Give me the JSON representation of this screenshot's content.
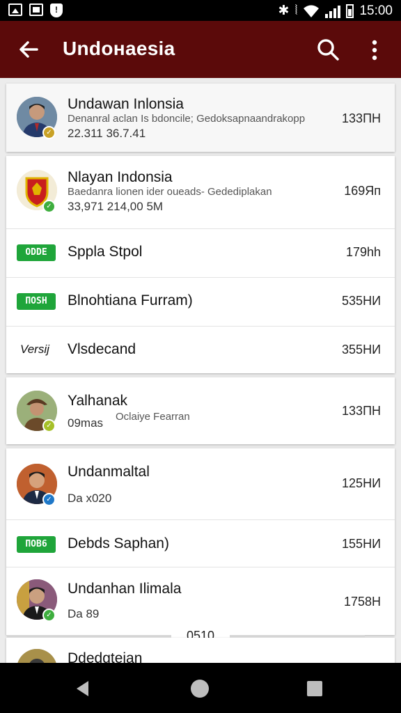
{
  "status_bar": {
    "time": "15:00",
    "icons": [
      "image-icon",
      "mail-icon",
      "shield-icon",
      "bluetooth-icon",
      "vibrate-icon",
      "wifi-icon",
      "signal-icon",
      "battery-icon"
    ]
  },
  "app_bar": {
    "title": "Undoнaesia",
    "icons": [
      "back-arrow-icon",
      "search-icon",
      "more-vert-icon"
    ]
  },
  "colors": {
    "app_bar": "#5b0a0a",
    "status_bar": "#000000",
    "tag": "#1fa53a",
    "badge_yellow": "#c9a227",
    "badge_green": "#3eae3e",
    "badge_blue": "#1f78c8"
  },
  "items": [
    {
      "name": "Undawan Inlonsia",
      "subtitle": "Dеnanral aclan Is bdoncile; Gedoksapnaandrakopp",
      "meta": "22.311  36.7.41",
      "time": "133ПН"
    },
    {
      "name": "Nlayan Indonsia",
      "subtitle": "Baedanra lionen ider oueads- Gedediplakan",
      "meta": "33,971  214,00 5M",
      "time": "169Яп"
    },
    {
      "tag": "ODDE",
      "name": "Sppla Stpol",
      "time": "179hh"
    },
    {
      "tag": "ПOSH",
      "name": "Blnohtiana Furram)",
      "time": "535НИ"
    },
    {
      "tag": "Versij",
      "name": "Vlsdecand",
      "time": "355НИ"
    },
    {
      "name": "Yalhanak",
      "subtitle": "Oclaiye Fearran",
      "meta": "09mas",
      "time": "133ПН"
    },
    {
      "name": "Undanmaltal",
      "meta": "Da x020",
      "time": "125НИ"
    },
    {
      "tag": "ПОВ6",
      "name": "Debds Saphan)",
      "time": "155НИ"
    },
    {
      "name": "Undanhan Ilimala",
      "meta": "Da 89",
      "time": "1758Н"
    },
    {
      "name": "Ddedgteian"
    }
  ],
  "pager": {
    "label": "0510"
  },
  "nav_bar": {
    "icons": [
      "back-icon",
      "home-icon",
      "recents-icon"
    ]
  }
}
